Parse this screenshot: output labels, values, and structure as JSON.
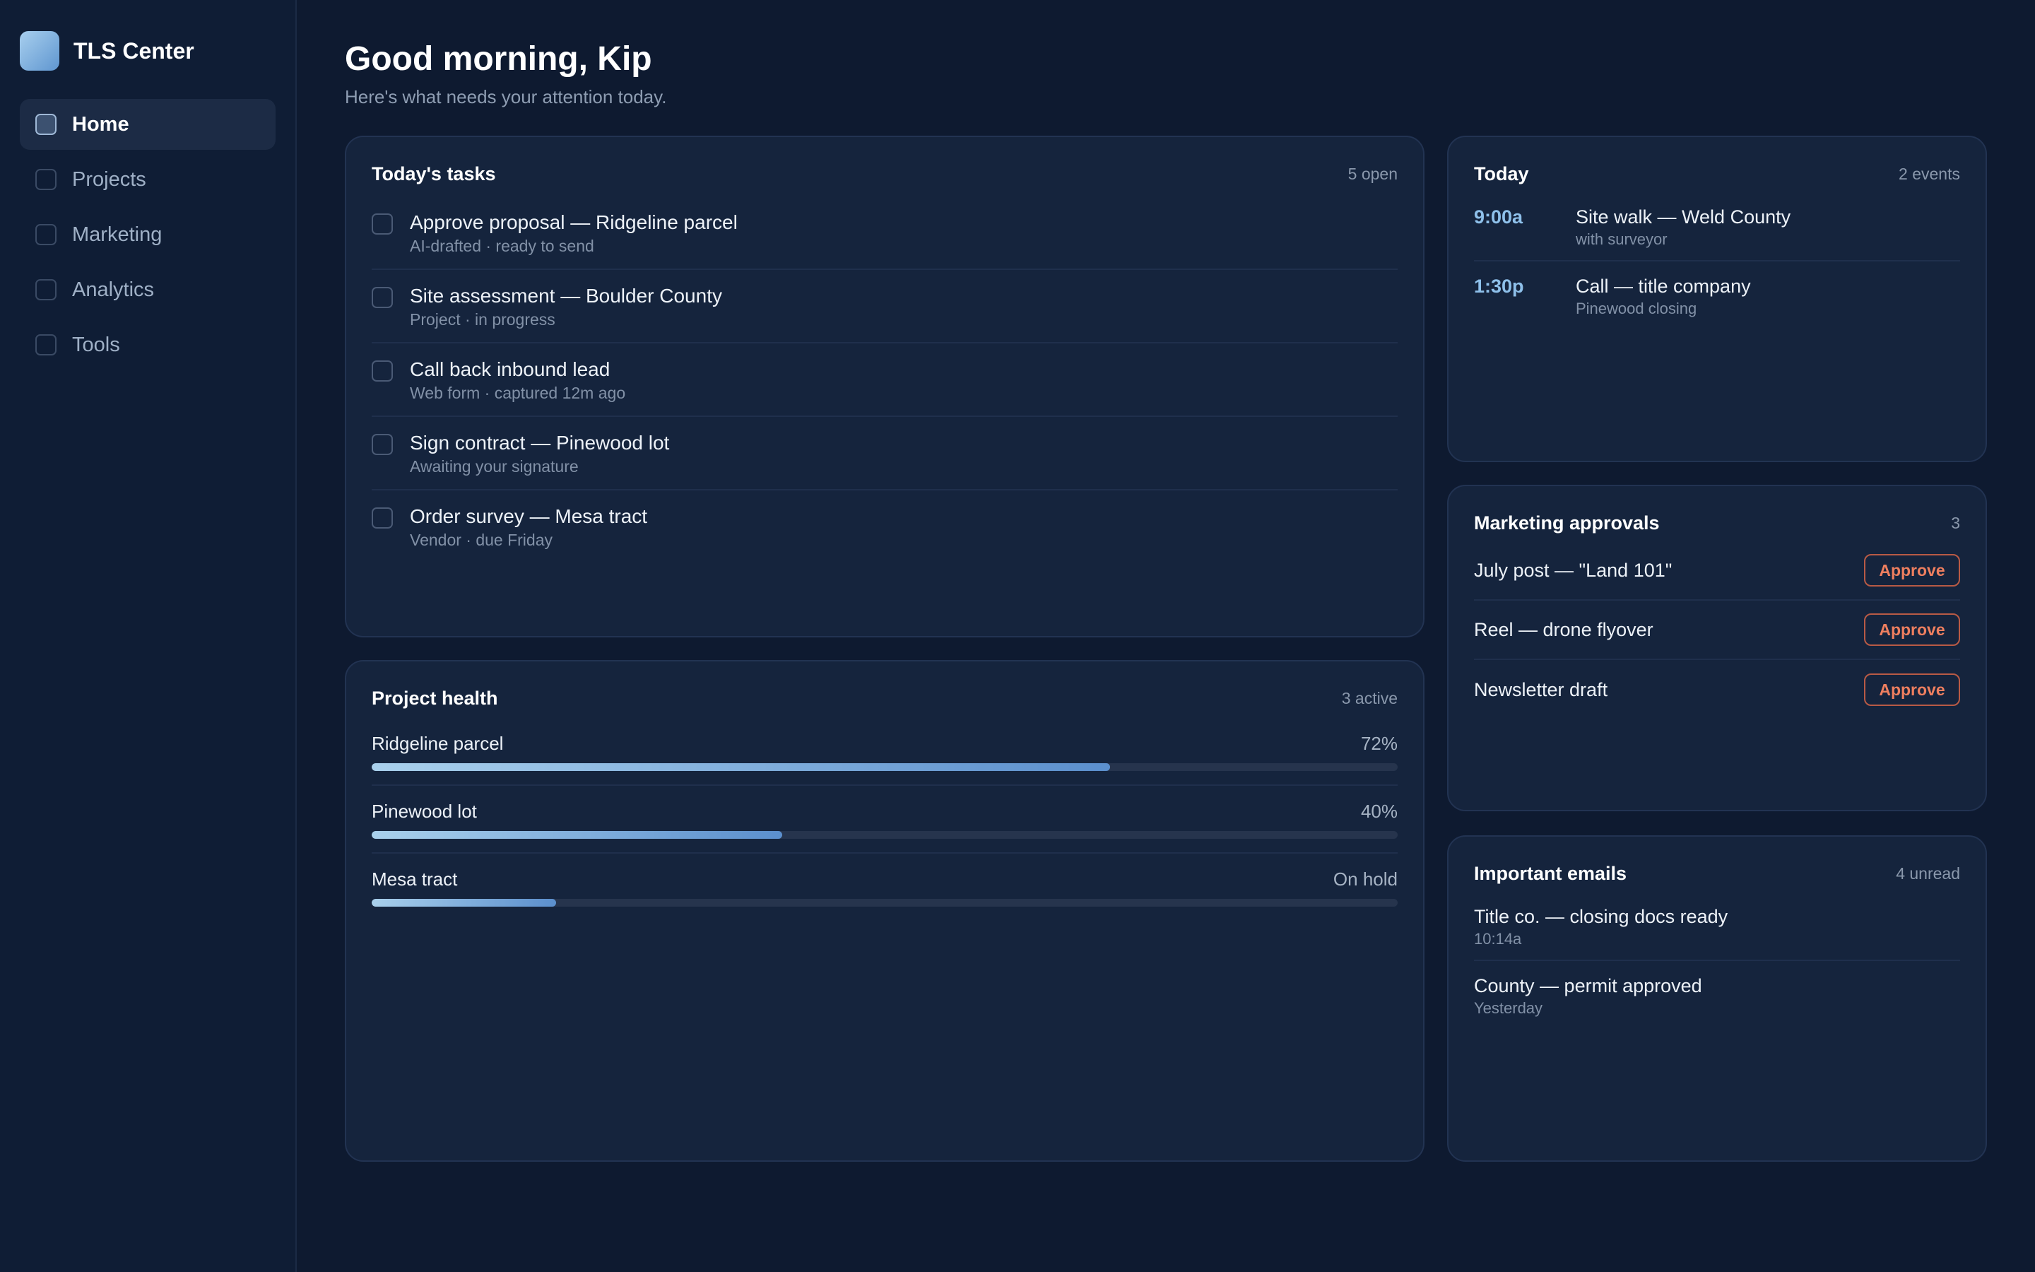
{
  "app": {
    "name": "TLS Center"
  },
  "nav": {
    "items": [
      {
        "label": "Home",
        "active": true
      },
      {
        "label": "Projects",
        "active": false
      },
      {
        "label": "Marketing",
        "active": false
      },
      {
        "label": "Analytics",
        "active": false
      },
      {
        "label": "Tools",
        "active": false
      }
    ]
  },
  "header": {
    "greeting": "Good morning, Kip",
    "subtitle": "Here's what needs your attention today."
  },
  "tasks": {
    "title": "Today's tasks",
    "meta": "5 open",
    "items": [
      {
        "title": "Approve proposal — Ridgeline parcel",
        "sub": "AI-drafted · ready to send"
      },
      {
        "title": "Site assessment — Boulder County",
        "sub": "Project · in progress"
      },
      {
        "title": "Call back inbound lead",
        "sub": "Web form · captured 12m ago"
      },
      {
        "title": "Sign contract — Pinewood lot",
        "sub": "Awaiting your signature"
      },
      {
        "title": "Order survey — Mesa tract",
        "sub": "Vendor · due Friday"
      }
    ]
  },
  "projects": {
    "title": "Project health",
    "meta": "3 active",
    "items": [
      {
        "name": "Ridgeline parcel",
        "status": "72%",
        "progress": 0.72
      },
      {
        "name": "Pinewood lot",
        "status": "40%",
        "progress": 0.4
      },
      {
        "name": "Mesa tract",
        "status": "On hold",
        "progress": 0.18
      }
    ]
  },
  "today": {
    "title": "Today",
    "meta": "2 events",
    "events": [
      {
        "time": "9:00a",
        "title": "Site walk — Weld County",
        "sub": "with surveyor"
      },
      {
        "time": "1:30p",
        "title": "Call — title company",
        "sub": "Pinewood closing"
      }
    ]
  },
  "approvals": {
    "title": "Marketing approvals",
    "meta": "3",
    "button_label": "Approve",
    "items": [
      {
        "label": "July post — \"Land 101\""
      },
      {
        "label": "Reel — drone flyover"
      },
      {
        "label": "Newsletter draft"
      }
    ]
  },
  "emails": {
    "title": "Important emails",
    "meta": "4 unread",
    "items": [
      {
        "subject": "Title co. — closing docs ready",
        "time": "10:14a"
      },
      {
        "subject": "County — permit approved",
        "time": "Yesterday"
      }
    ]
  },
  "colors": {
    "background": "#0e1a30",
    "card": "#15243d",
    "accent": "#8ec0ea",
    "approve": "#ef7f5f"
  }
}
